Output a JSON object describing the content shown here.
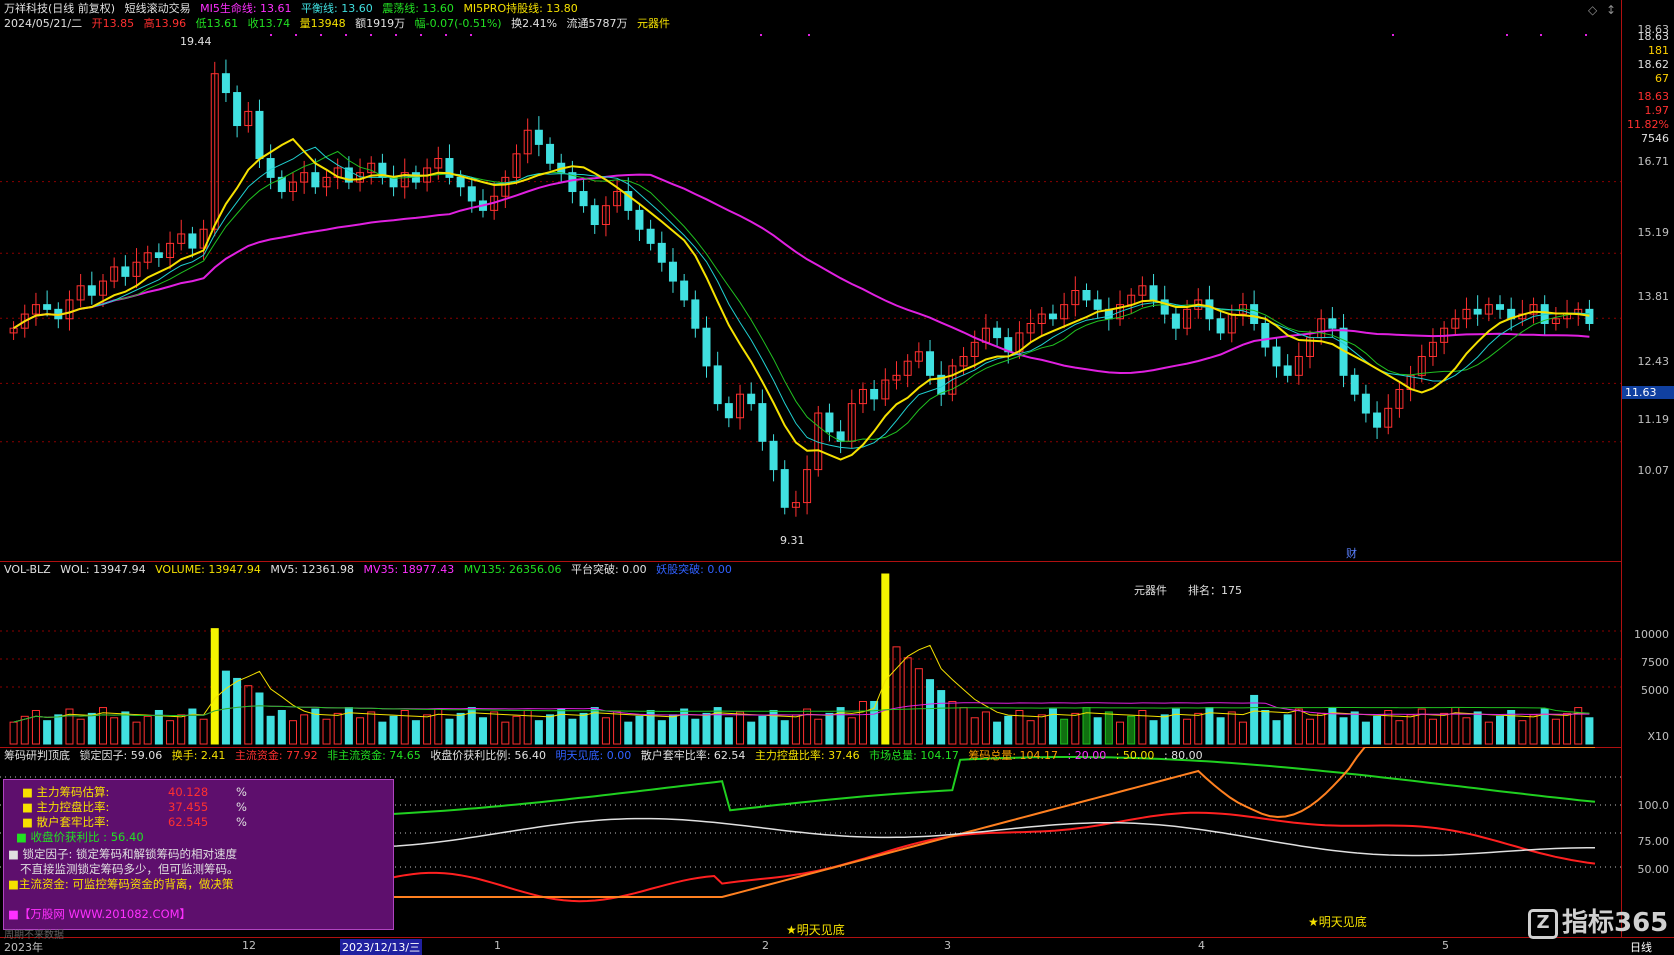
{
  "colors": {
    "up": "#ff3030",
    "down": "#40e0e0",
    "ma_yellow": "#f5e100",
    "ma_magenta": "#e020e0",
    "ma_green": "#20c020",
    "grid": "#8b0000",
    "panel_border": "#b01010"
  },
  "main": {
    "header": {
      "stock": "万祥科技(日线 前复权)",
      "indicator": "短线滚动交易",
      "life_line": "MI5生命线: 13.61",
      "balance_line": "平衡线: 13.60",
      "shock_line": "震荡线: 13.60",
      "pro_line": "MI5PRO持股线: 13.80"
    },
    "info_line": {
      "date": "2024/05/21/二",
      "open": "开13.85",
      "high": "高13.96",
      "low": "低13.61",
      "close": "收13.74",
      "vol": "量13948",
      "amount": "额1919万",
      "change": "幅-0.07(-0.51%)",
      "turnover": "换2.41%",
      "float": "流通5787万",
      "sector": "元器件"
    },
    "high_mark": "19.44",
    "low_mark": "9.31",
    "cai_label": "财",
    "price_axis": [
      "18.63",
      "16.71",
      "15.19",
      "13.81",
      "12.43",
      "11.19",
      "10.07"
    ],
    "side_info": [
      "18.63",
      "181",
      "18.62",
      "67",
      "18.63",
      "1.97",
      "11.82%",
      "7546"
    ],
    "current_price": "11.63",
    "chart_data": {
      "type": "candlestick",
      "ylim": [
        9.0,
        19.8
      ],
      "closes": [
        13.6,
        13.9,
        14.1,
        14.0,
        13.8,
        14.2,
        14.5,
        14.3,
        14.6,
        14.9,
        14.7,
        15.0,
        15.2,
        15.1,
        15.4,
        15.6,
        15.3,
        15.7,
        19.0,
        18.6,
        17.9,
        18.2,
        17.2,
        16.8,
        16.5,
        16.7,
        16.9,
        16.6,
        16.8,
        17.0,
        16.7,
        16.9,
        17.1,
        16.8,
        16.6,
        16.9,
        16.7,
        17.0,
        17.2,
        16.8,
        16.6,
        16.3,
        16.1,
        16.4,
        16.8,
        17.3,
        17.8,
        17.5,
        17.1,
        16.9,
        16.5,
        16.2,
        15.8,
        16.2,
        16.5,
        16.1,
        15.7,
        15.4,
        15.0,
        14.6,
        14.2,
        13.6,
        12.8,
        12.0,
        11.7,
        12.2,
        12.0,
        11.2,
        10.6,
        9.8,
        9.9,
        10.6,
        11.8,
        11.4,
        11.2,
        12.0,
        12.3,
        12.1,
        12.5,
        12.6,
        12.9,
        13.1,
        12.6,
        12.2,
        12.8,
        13.0,
        13.3,
        13.6,
        13.4,
        13.1,
        13.5,
        13.7,
        13.9,
        13.8,
        14.1,
        14.4,
        14.2,
        14.0,
        13.8,
        14.1,
        14.3,
        14.5,
        14.2,
        13.9,
        13.6,
        14.0,
        14.2,
        13.8,
        13.5,
        13.9,
        14.1,
        13.7,
        13.2,
        12.8,
        12.6,
        13.0,
        13.4,
        13.8,
        13.6,
        12.6,
        12.2,
        11.8,
        11.5,
        11.9,
        12.3,
        12.6,
        13.0,
        13.3,
        13.6,
        13.8,
        14.0,
        13.9,
        14.1,
        14.0,
        13.8,
        13.9,
        14.1,
        13.7,
        13.8,
        13.9,
        14.0,
        13.7
      ]
    }
  },
  "volume": {
    "header": {
      "name": "VOL-BLZ",
      "wol": "WOL: 13947.94",
      "volume": "VOLUME: 13947.94",
      "mv5": "MV5: 12361.98",
      "mv35": "MV35: 18977.43",
      "mv135": "MV135: 26356.06",
      "platform": "平台突破: 0.00",
      "breakout": "妖股突破: 0.00"
    },
    "sector": "元器件",
    "rank": "排名：175",
    "axis": [
      "10000",
      "7500",
      "5000"
    ],
    "unit": "X10"
  },
  "chip": {
    "header": {
      "name": "筹码研判顶底",
      "lock": "锁定因子: 59.06",
      "turnover": "换手: 2.41",
      "main_fund": "主流资金: 77.92",
      "non_main": "非主流资金: 74.65",
      "profit_ratio": "收盘价获利比例: 56.40",
      "tomorrow": "明天见底: 0.00",
      "retail_ratio": "散户套牢比率: 62.54",
      "control_ratio": "主力控盘比率: 37.46",
      "market_total": "市场总量: 104.17",
      "chip_total": "筹码总量: 104.17",
      "v20": ": 20.00",
      "v50": ": 50.00",
      "v80": ": 80.00"
    },
    "axis": [
      "100.0",
      "75.00",
      "50.00"
    ],
    "bottom_labels": [
      "明天见底",
      "明天见底"
    ],
    "info_box": {
      "row1_label": "主力筹码估算:",
      "row1_value": "40.128",
      "row1_unit": "%",
      "row2_label": "主力控盘比率:",
      "row2_value": "37.455",
      "row2_unit": "%",
      "row3_label": "散户套牢比率:",
      "row3_value": "62.545",
      "row3_unit": "%",
      "row4": "收盘价获利比 : 56.40",
      "row5": "锁定因子:  锁定筹码和解锁筹码的相对速度",
      "row6": "不直接监测锁定筹码多少，但可监测筹码。",
      "row7": "主流资金: 可监控筹码资金的背离，做决策",
      "row8": "【万股网 WWW.201082.COM】"
    }
  },
  "bottom": {
    "dates": [
      "2023年",
      "12",
      "2023/12/13/三",
      "1",
      "2",
      "3",
      "4",
      "5"
    ],
    "period": "日线",
    "hint": "周期不来数据"
  },
  "watermark": "指标365"
}
